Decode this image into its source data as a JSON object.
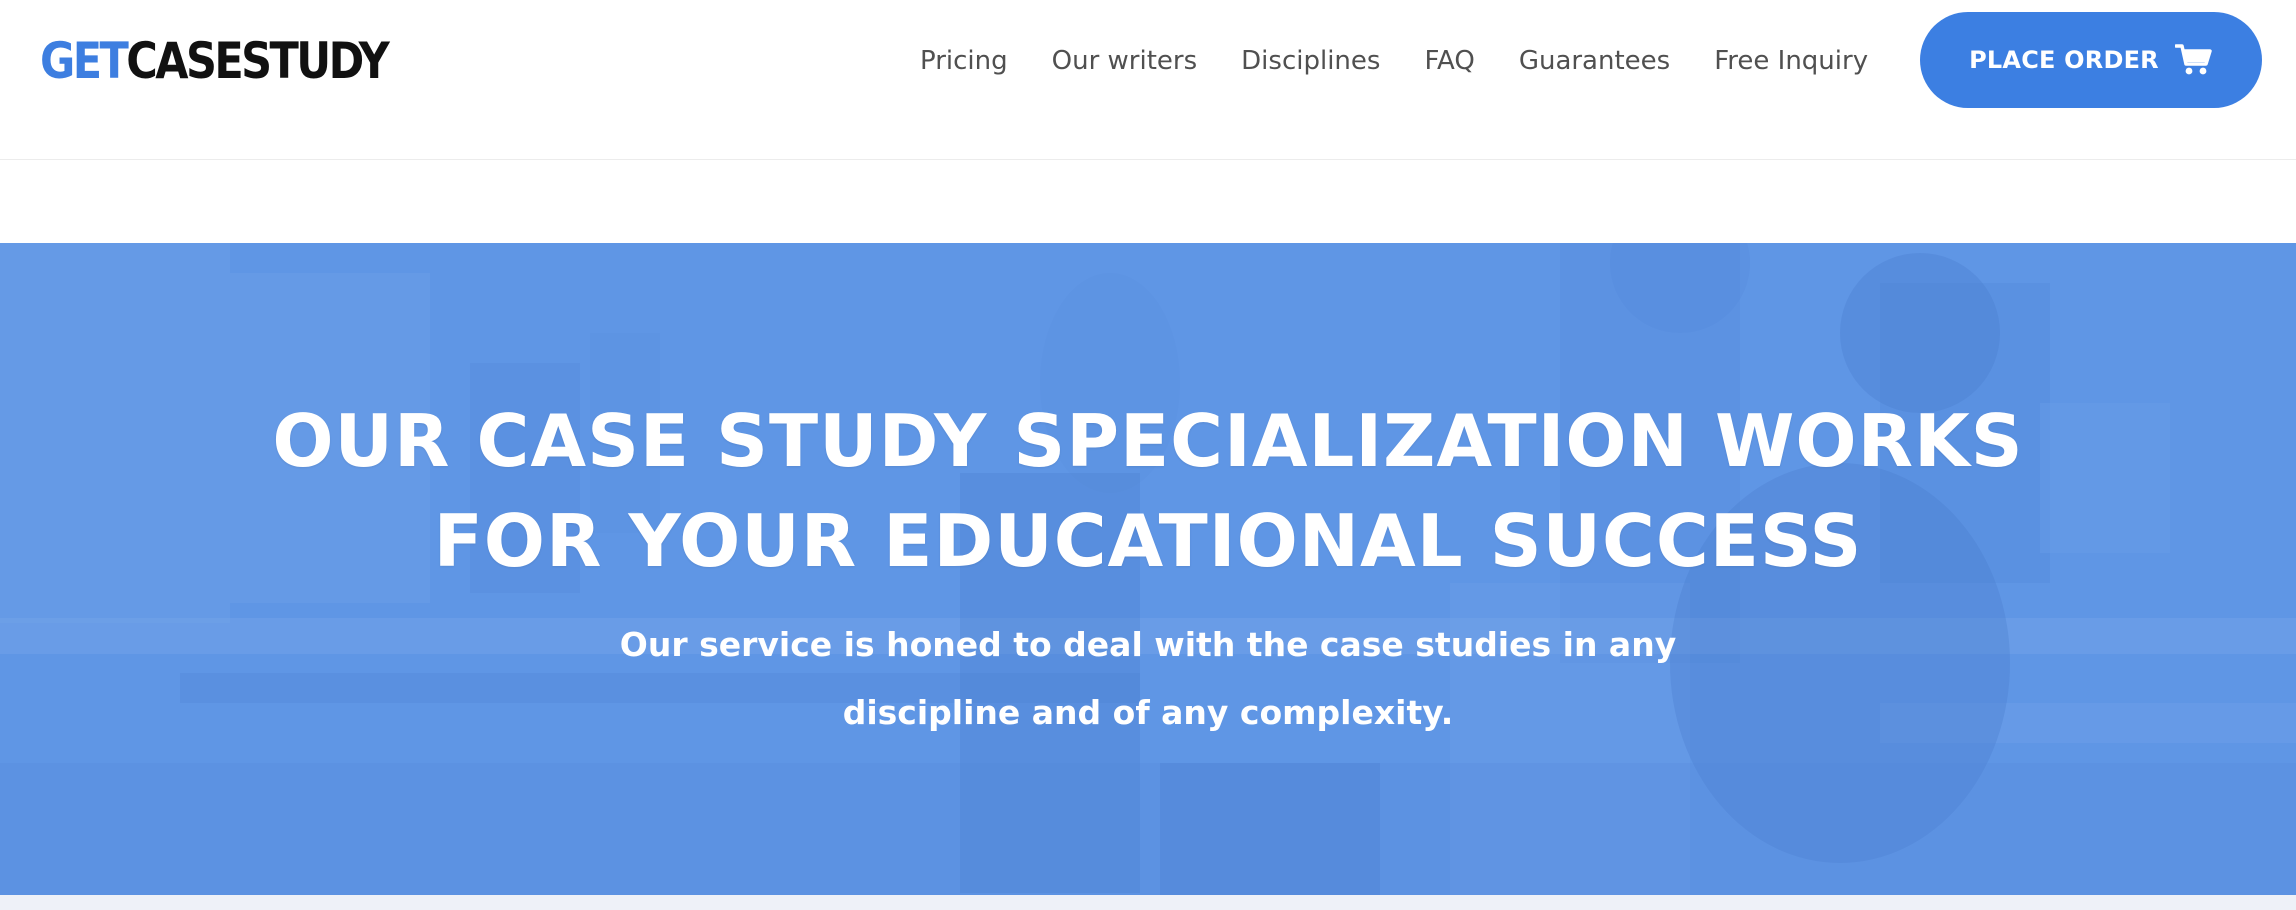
{
  "header": {
    "logo": {
      "part1": "GET",
      "part2": "CASESTUDY"
    },
    "nav": [
      {
        "label": "Pricing"
      },
      {
        "label": "Our writers"
      },
      {
        "label": "Disciplines"
      },
      {
        "label": "FAQ"
      },
      {
        "label": "Guarantees"
      },
      {
        "label": "Free Inquiry"
      }
    ],
    "order_button": {
      "label": "PLACE ORDER",
      "icon": "cart-icon"
    }
  },
  "hero": {
    "title_line1": "OUR CASE STUDY SPECIALIZATION WORKS",
    "title_line2": "FOR YOUR EDUCATIONAL SUCCESS",
    "subtitle_line1": "Our service is honed to deal with the case studies in any",
    "subtitle_line2": "discipline and of any complexity."
  },
  "colors": {
    "brand_blue": "#3c7fe2",
    "hero_overlay": "#5f95e4",
    "logo_dark": "#111111",
    "nav_text": "#505050"
  }
}
